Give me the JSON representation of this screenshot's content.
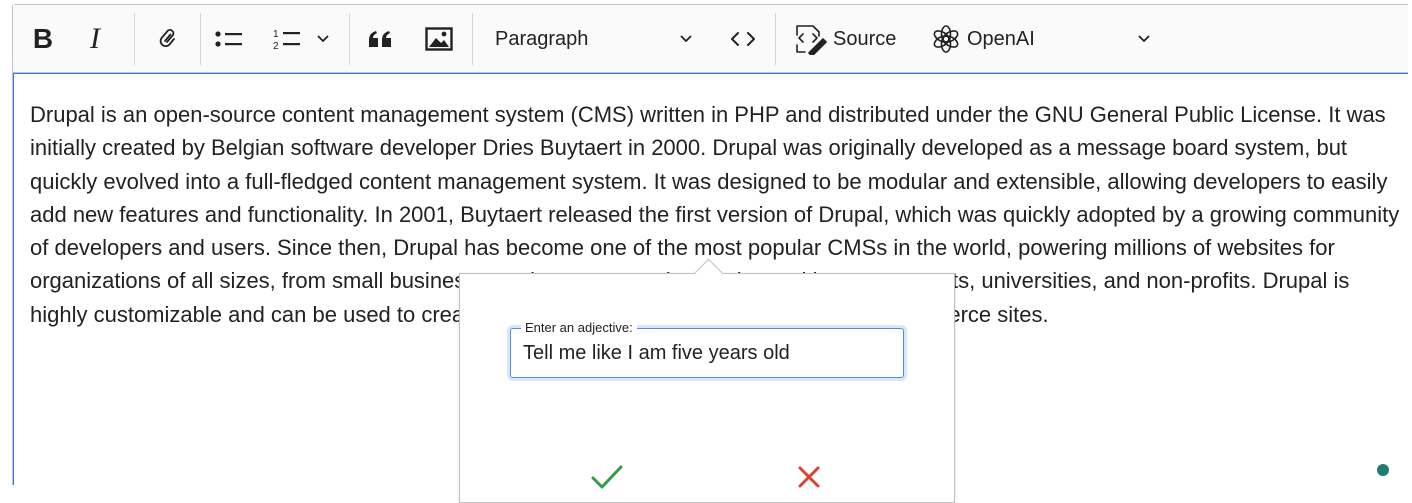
{
  "toolbar": {
    "bold_label": "B",
    "italic_label": "I",
    "heading_select": "Paragraph",
    "source_label": "Source",
    "openai_label": "OpenAI",
    "icons": [
      "bold-icon",
      "italic-icon",
      "link-icon",
      "bulleted-list-icon",
      "numbered-list-icon",
      "chevron-down-icon",
      "blockquote-icon",
      "image-icon",
      "code-icon",
      "source-icon",
      "openai-icon"
    ]
  },
  "content": {
    "paragraph": "Drupal is an open-source content management system (CMS) written in PHP and distributed under the GNU General Public License. It was initially created by Belgian software developer Dries Buytaert in 2000. Drupal was originally developed as a message board system, but quickly evolved into a full-fledged content management system. It was designed to be modular and extensible, allowing developers to easily add new features and functionality. In 2001, Buytaert released the first version of Drupal, which was quickly adopted by a growing community of developers and users. Since then, Drupal has become one of the most popular CMSs in the world, powering millions of websites for organizations of all sizes, from small businesses to large corporations. It is used by governments, universities, and non-profits. Drupal is highly customizable and can be used to create anything from simple blogs to complex e-commerce sites."
  },
  "balloon": {
    "field_label": "Enter an adjective:",
    "field_value": "Tell me like I am five years old"
  },
  "colors": {
    "focus_border": "#2977ff",
    "save_green": "#2f9e44",
    "cancel_red": "#d64532",
    "status_dot": "#1c7e73"
  }
}
